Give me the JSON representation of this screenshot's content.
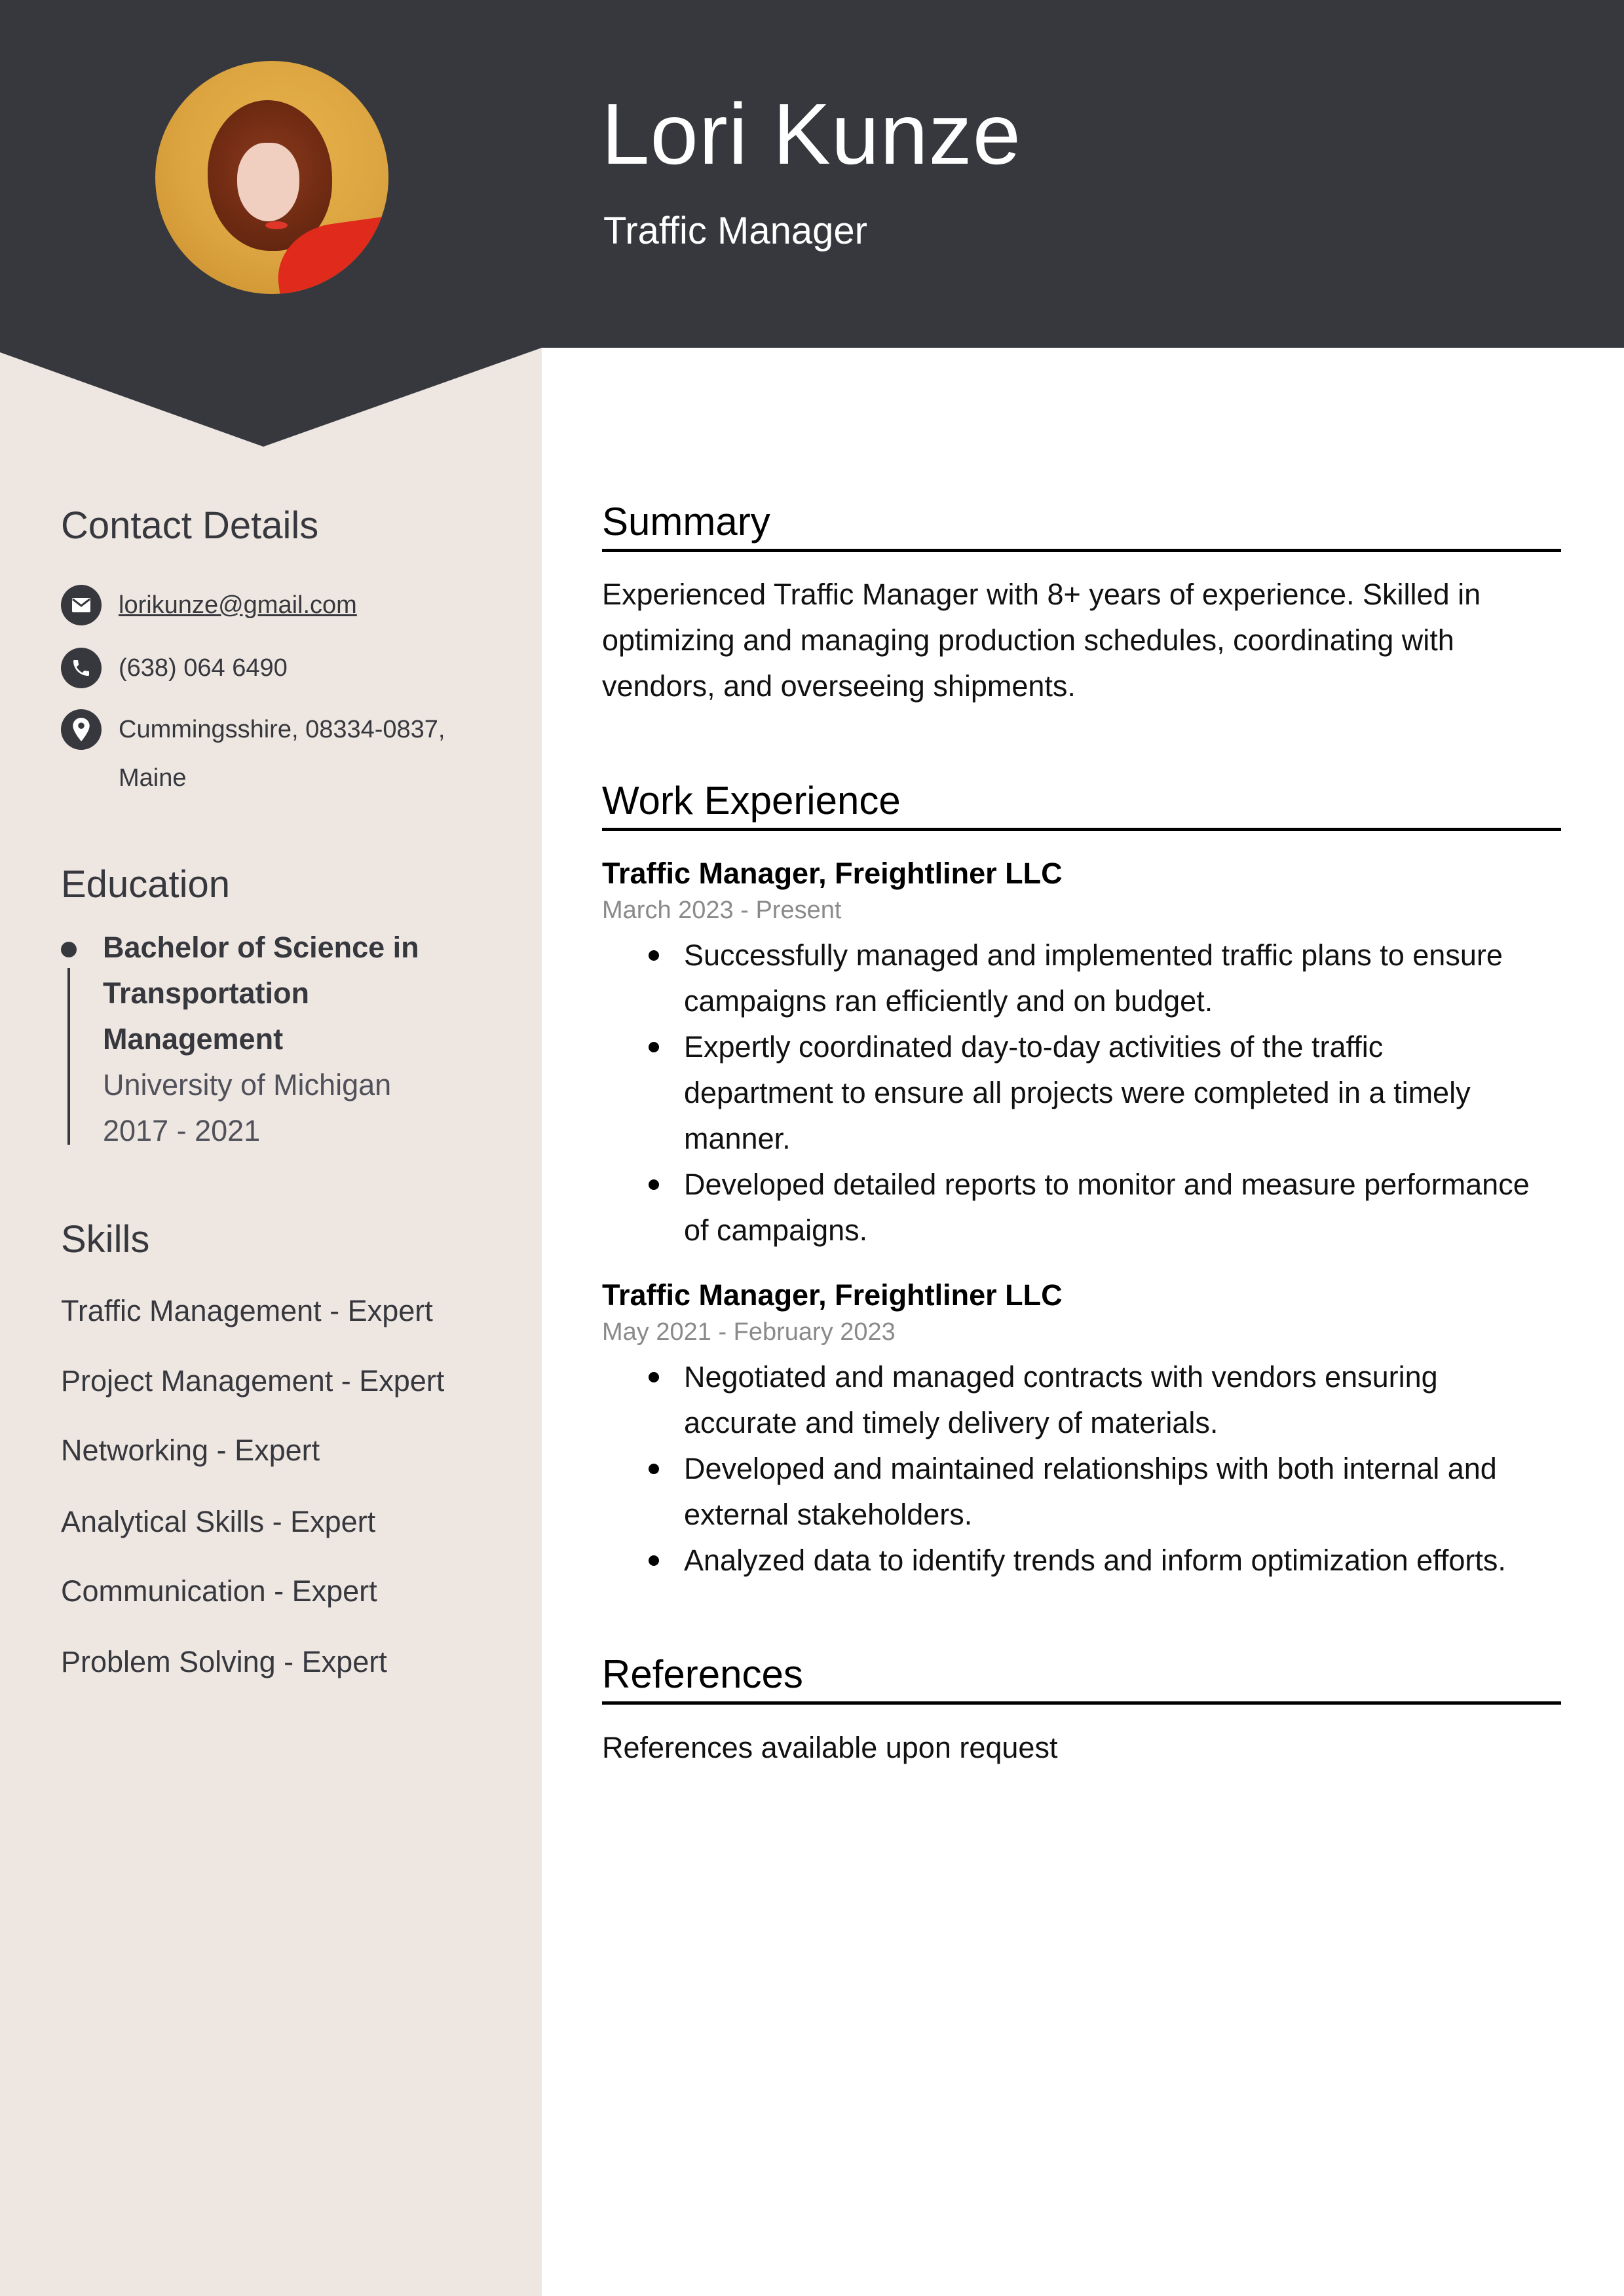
{
  "header": {
    "name": "Lori Kunze",
    "job_title": "Traffic Manager",
    "photo_alt": "profile-photo",
    "colors": {
      "header_bg": "#37383e",
      "sidebar_bg": "#ede6e1",
      "text_dark": "#37383e"
    }
  },
  "sidebar": {
    "contact": {
      "heading": "Contact Details",
      "items": [
        {
          "icon": "envelope-icon",
          "text": "lorikunze@gmail.com",
          "is_link": true
        },
        {
          "icon": "phone-icon",
          "text": "(638) 064 6490",
          "is_link": false
        },
        {
          "icon": "location-pin-icon",
          "line1": "Cummingsshire, 08334-0837,",
          "line2": "Maine",
          "is_link": false
        }
      ]
    },
    "education": {
      "heading": "Education",
      "entries": [
        {
          "degree_lines": [
            "Bachelor of Science in",
            "Transportation",
            "Management"
          ],
          "school": "University of Michigan",
          "years": "2017 - 2021"
        }
      ]
    },
    "skills": {
      "heading": "Skills",
      "items": [
        "Traffic Management - Expert",
        "Project Management - Expert",
        "Networking - Expert",
        "Analytical Skills - Expert",
        "Communication - Expert",
        "Problem Solving - Expert"
      ]
    }
  },
  "main": {
    "summary": {
      "heading": "Summary",
      "lines": [
        "Experienced Traffic Manager with 8+ years of experience. Skilled in",
        "optimizing and managing production schedules, coordinating with",
        "vendors, and overseeing shipments."
      ]
    },
    "experience": {
      "heading": "Work Experience",
      "jobs": [
        {
          "title": "Traffic Manager, Freightliner LLC",
          "dates": "March 2023 - Present",
          "bullets": [
            [
              "Successfully managed and implemented traffic plans to ensure",
              "campaigns ran efficiently and on budget."
            ],
            [
              "Expertly coordinated day-to-day activities of the traffic",
              "department to ensure all projects were completed in a timely",
              "manner."
            ],
            [
              "Developed detailed reports to monitor and measure performance",
              "of campaigns."
            ]
          ]
        },
        {
          "title": "Traffic Manager, Freightliner LLC",
          "dates": "May 2021 - February 2023",
          "bullets": [
            [
              "Negotiated and managed contracts with vendors ensuring",
              "accurate and timely delivery of materials."
            ],
            [
              "Developed and maintained relationships with both internal and",
              "external stakeholders."
            ],
            [
              "Analyzed data to identify trends and inform optimization efforts."
            ]
          ]
        }
      ]
    },
    "references": {
      "heading": "References",
      "text": "References available upon request"
    }
  }
}
